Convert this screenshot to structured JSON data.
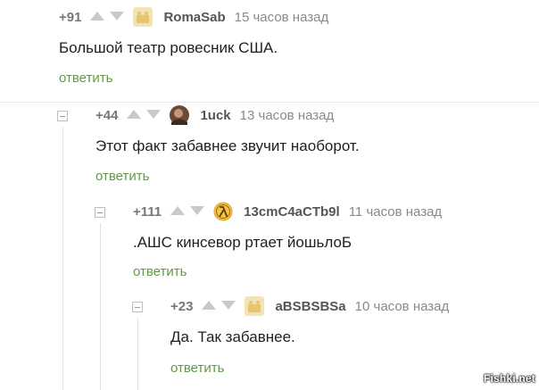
{
  "comments": [
    {
      "score": "+91",
      "username": "RomaSab",
      "time": "15 часов назад",
      "text": "Большой театр ровесник США.",
      "reply": "ответить",
      "avatar_icon": "placeholder-avatar-icon"
    },
    {
      "score": "+44",
      "username": "1uck",
      "time": "13 часов назад",
      "text": "Этот факт забавнее звучит наоборот.",
      "reply": "ответить",
      "avatar_icon": "photo-avatar-icon"
    },
    {
      "score": "+111",
      "username": "13cmC4aCTb9l",
      "time": "11 часов назад",
      "text": ".АШС кинсевор ртает йошьлоБ",
      "reply": "ответить",
      "avatar_icon": "lambda-avatar-icon"
    },
    {
      "score": "+23",
      "username": "aBSBSBSa",
      "time": "10 часов назад",
      "text": "Да. Так забавнее.",
      "reply": "ответить",
      "avatar_icon": "placeholder-avatar-icon"
    }
  ],
  "watermark": "Fishki.net",
  "colors": {
    "reply_link": "#5f9a46",
    "vote_arrow": "#c9c9c9",
    "username": "#555555",
    "timestamp": "#8a8a8a"
  }
}
